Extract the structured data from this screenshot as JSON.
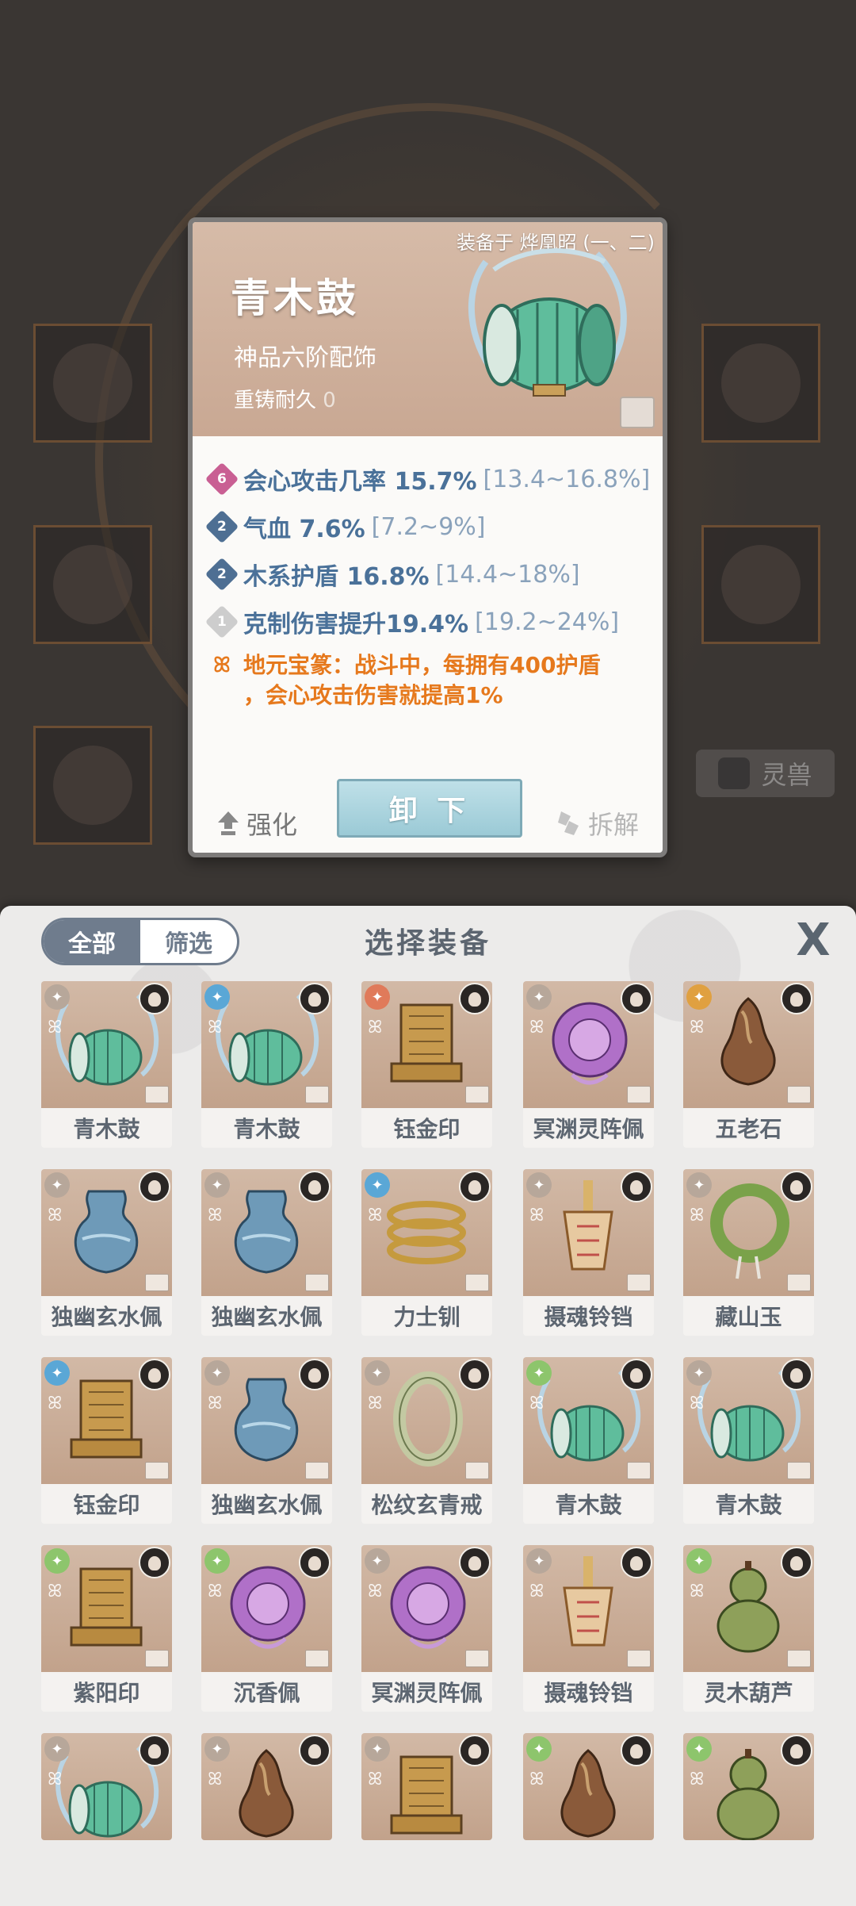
{
  "background": {
    "beast_button_label": "灵兽"
  },
  "detail": {
    "equipped_label": "装备于 烨凰昭 (一、二)",
    "name": "青木鼓",
    "grade": "神品六阶配饰",
    "durability_label": "重铸耐久",
    "durability_value": "0",
    "attributes": [
      {
        "badge": "6",
        "badge_color": "#c95f93",
        "text": "会心攻击几率 15.7%",
        "range": "[13.4~16.8%]"
      },
      {
        "badge": "2",
        "badge_color": "#4e6f93",
        "text": "气血 7.6%",
        "range": "[7.2~9%]"
      },
      {
        "badge": "2",
        "badge_color": "#4e6f93",
        "text": "木系护盾 16.8%",
        "range": "[14.4~18%]"
      },
      {
        "badge": "1",
        "badge_color": "#cdcdcd",
        "text": "克制伤害提升19.4%",
        "range": "[19.2~24%]"
      }
    ],
    "special_line1": "地元宝篆：战斗中，每拥有400护盾",
    "special_line2": "，会心攻击伤害就提高1%",
    "special_color": "#e6791d",
    "strengthen_label": "强化",
    "unequip_label": "卸 下",
    "dismantle_label": "拆解"
  },
  "panel": {
    "tab_all": "全部",
    "tab_filter": "筛选",
    "title": "选择装备",
    "close_label": "X"
  },
  "items": [
    {
      "name": "青木鼓",
      "element_color": "#b7a79a",
      "icon": "drum-icon"
    },
    {
      "name": "青木鼓",
      "element_color": "#5aa7d6",
      "icon": "drum-icon"
    },
    {
      "name": "钰金印",
      "element_color": "#e07a5a",
      "icon": "seal-icon"
    },
    {
      "name": "冥渊灵阵佩",
      "element_color": "#b7a79a",
      "icon": "pendant-icon"
    },
    {
      "name": "五老石",
      "element_color": "#e0a040",
      "icon": "stone-icon"
    },
    {
      "name": "独幽玄水佩",
      "element_color": "#b7a79a",
      "icon": "jar-icon"
    },
    {
      "name": "独幽玄水佩",
      "element_color": "#b7a79a",
      "icon": "jar-icon"
    },
    {
      "name": "力士钏",
      "element_color": "#5aa7d6",
      "icon": "bracelet-icon"
    },
    {
      "name": "摄魂铃铛",
      "element_color": "#b7a79a",
      "icon": "bell-icon"
    },
    {
      "name": "藏山玉",
      "element_color": "#b7a79a",
      "icon": "jade-icon"
    },
    {
      "name": "钰金印",
      "element_color": "#5aa7d6",
      "icon": "seal-icon"
    },
    {
      "name": "独幽玄水佩",
      "element_color": "#b7a79a",
      "icon": "jar-icon"
    },
    {
      "name": "松纹玄青戒",
      "element_color": "#b7a79a",
      "icon": "ring-icon"
    },
    {
      "name": "青木鼓",
      "element_color": "#8dc56c",
      "icon": "drum-icon"
    },
    {
      "name": "青木鼓",
      "element_color": "#b7a79a",
      "icon": "drum-icon"
    },
    {
      "name": "紫阳印",
      "element_color": "#8dc56c",
      "icon": "seal-icon"
    },
    {
      "name": "沉香佩",
      "element_color": "#8dc56c",
      "icon": "pendant-icon"
    },
    {
      "name": "冥渊灵阵佩",
      "element_color": "#b7a79a",
      "icon": "pendant-icon"
    },
    {
      "name": "摄魂铃铛",
      "element_color": "#b7a79a",
      "icon": "bell-icon"
    },
    {
      "name": "灵木葫芦",
      "element_color": "#8dc56c",
      "icon": "gourd-icon"
    },
    {
      "name": "",
      "element_color": "#b7a79a",
      "icon": "drum-icon"
    },
    {
      "name": "",
      "element_color": "#b7a79a",
      "icon": "stone-icon"
    },
    {
      "name": "",
      "element_color": "#b7a79a",
      "icon": "seal-icon"
    },
    {
      "name": "",
      "element_color": "#8dc56c",
      "icon": "stone-icon"
    },
    {
      "name": "",
      "element_color": "#8dc56c",
      "icon": "gourd-icon"
    }
  ]
}
